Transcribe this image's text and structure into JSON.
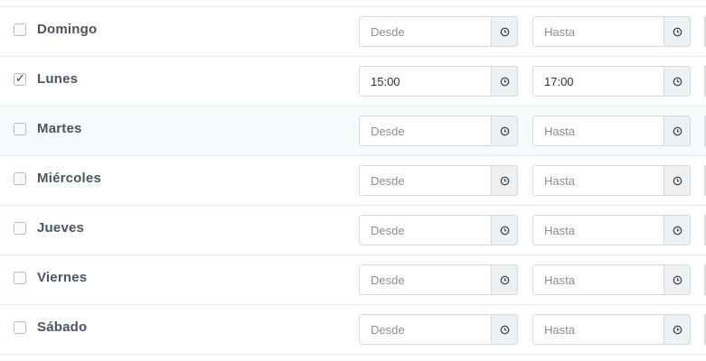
{
  "schedule": {
    "rows": [
      {
        "day": "Domingo",
        "checked": false,
        "from_value": "",
        "to_value": "",
        "from_placeholder": "Desde",
        "to_placeholder": "Hasta"
      },
      {
        "day": "Lunes",
        "checked": true,
        "from_value": "15:00",
        "to_value": "17:00",
        "from_placeholder": "Desde",
        "to_placeholder": "Hasta"
      },
      {
        "day": "Martes",
        "checked": false,
        "from_value": "",
        "to_value": "",
        "from_placeholder": "Desde",
        "to_placeholder": "Hasta"
      },
      {
        "day": "Miércoles",
        "checked": false,
        "from_value": "",
        "to_value": "",
        "from_placeholder": "Desde",
        "to_placeholder": "Hasta"
      },
      {
        "day": "Jueves",
        "checked": false,
        "from_value": "",
        "to_value": "",
        "from_placeholder": "Desde",
        "to_placeholder": "Hasta"
      },
      {
        "day": "Viernes",
        "checked": false,
        "from_value": "",
        "to_value": "",
        "from_placeholder": "Desde",
        "to_placeholder": "Hasta"
      },
      {
        "day": "Sábado",
        "checked": false,
        "from_value": "",
        "to_value": "",
        "from_placeholder": "Desde",
        "to_placeholder": "Hasta"
      }
    ],
    "highlighted_day": "Martes",
    "icons": {
      "time_addon": "clock-icon",
      "checkbox_mark": "checkmark-icon"
    },
    "colors": {
      "day_label": "#4a5561",
      "addon_bg": "#eef1f4",
      "row_highlight": "#f5fafc",
      "border": "#d6dbe0"
    }
  }
}
